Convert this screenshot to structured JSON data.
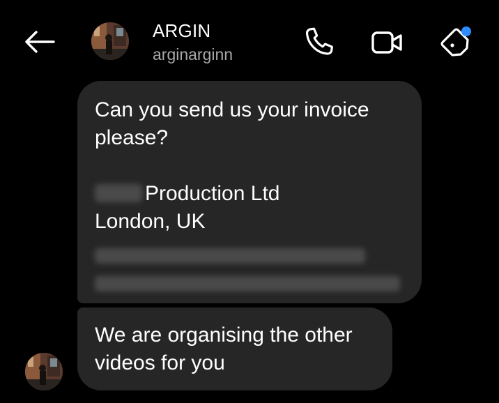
{
  "header": {
    "contact_name": "ARGIN",
    "contact_username": "arginarginn",
    "back_icon": "arrow-left-icon",
    "call_icon": "phone-icon",
    "video_icon": "video-camera-icon",
    "tag_icon": "tag-icon",
    "notification_dot_color": "#2f8cff"
  },
  "messages": [
    {
      "lines": [
        "Can you send us your invoice",
        "please?",
        "",
        "Production Ltd",
        "London, UK"
      ]
    },
    {
      "lines": [
        "We are organising the other",
        "videos for you"
      ]
    }
  ],
  "colors": {
    "background": "#000000",
    "bubble": "#262626",
    "text": "#ffffff",
    "secondary_text": "#a8a8a8"
  }
}
